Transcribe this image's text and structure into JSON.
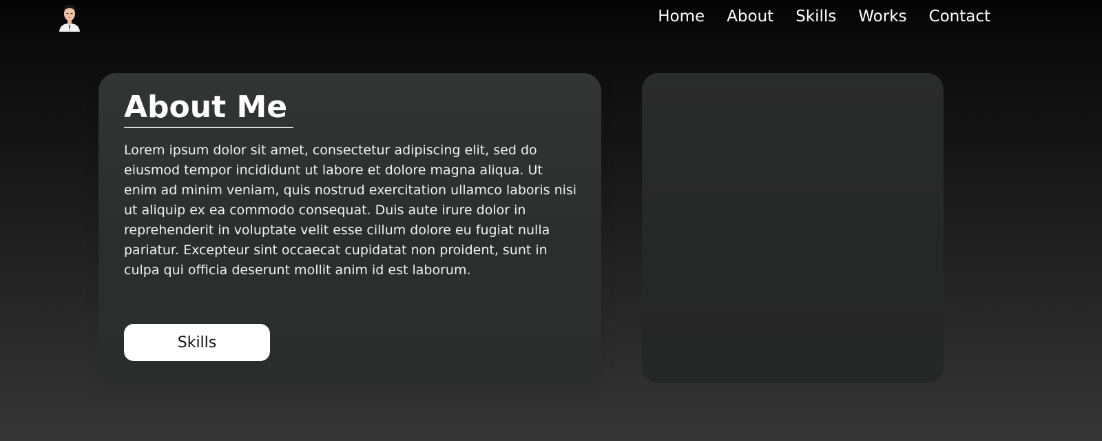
{
  "header": {
    "avatar_icon": "profile-avatar",
    "nav": [
      {
        "label": "Home"
      },
      {
        "label": "About"
      },
      {
        "label": "Skills"
      },
      {
        "label": "Works"
      },
      {
        "label": "Contact"
      }
    ]
  },
  "about": {
    "title": "About Me",
    "body": "Lorem ipsum dolor sit amet, consectetur adipiscing elit, sed do eiusmod tempor incididunt ut labore et dolore magna aliqua. Ut enim ad minim veniam, quis nostrud exercitation ullamco laboris nisi ut aliquip ex ea commodo consequat. Duis aute irure dolor in reprehenderit in voluptate velit esse cillum dolore eu fugiat nulla pariatur. Excepteur sint occaecat cupidatat non proident, sunt in culpa qui officia deserunt mollit anim id est laborum.",
    "button_label": "Skills"
  },
  "colors": {
    "background_top": "#040404",
    "background_bottom": "#363636",
    "card": "#2e3030",
    "button": "#ffffff",
    "text": "#ffffff"
  }
}
